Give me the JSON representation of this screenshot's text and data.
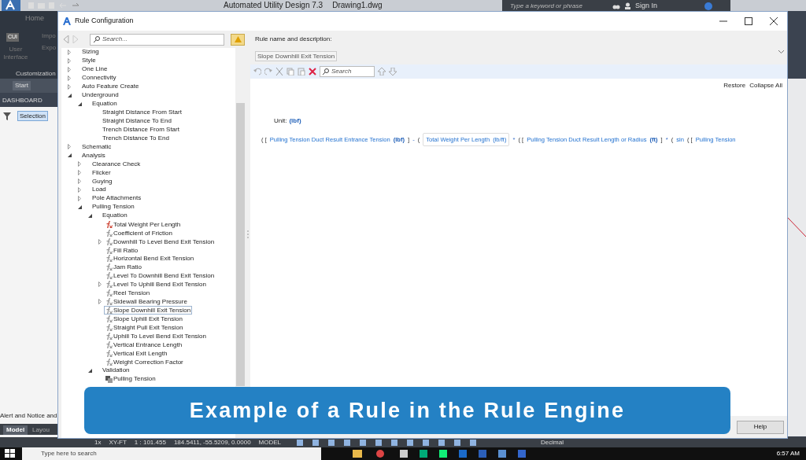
{
  "app": {
    "title": "Automated Utility Design 7.3",
    "document": "Drawing1.dwg",
    "search_placeholder": "Type a keyword or phrase",
    "sign_in": "Sign In",
    "ribbon_tab": "Home",
    "ribbon_items": [
      "Impo",
      "Expo"
    ],
    "cui_label": "CUI",
    "cui_caption": "User Interface",
    "panel_title": "Customization",
    "start_tab": "Start",
    "dashboard": "DASHBOARD",
    "selection": "Selection",
    "alert": "Alert and Notice and",
    "layout_tabs": [
      {
        "label": "Model",
        "selected": true
      },
      {
        "label": "Layou",
        "selected": false
      }
    ]
  },
  "dialog": {
    "title": "Rule Configuration",
    "search_placeholder": "Search...",
    "tree": [
      {
        "label": "Sizing",
        "expanded": false
      },
      {
        "label": "Style",
        "expanded": false
      },
      {
        "label": "One Line",
        "expanded": false
      },
      {
        "label": "Connectivity",
        "expanded": false
      },
      {
        "label": "Auto Feature Create",
        "expanded": false
      },
      {
        "label": "Underground",
        "expanded": true,
        "children": [
          {
            "label": "Equation",
            "expanded": true,
            "children": [
              {
                "label": "Straight Distance From Start"
              },
              {
                "label": "Straight Distance To End"
              },
              {
                "label": "Trench Distance From Start"
              },
              {
                "label": "Trench Distance To End"
              }
            ]
          }
        ]
      },
      {
        "label": "Schematic",
        "expanded": false
      },
      {
        "label": "Analysis",
        "expanded": true,
        "children": [
          {
            "label": "Clearance Check",
            "expanded": false
          },
          {
            "label": "Flicker",
            "expanded": false
          },
          {
            "label": "Guying",
            "expanded": false
          },
          {
            "label": "Load",
            "expanded": false
          },
          {
            "label": "Pole Attachments",
            "expanded": false
          },
          {
            "label": "Pulling Tension",
            "expanded": true,
            "children": [
              {
                "label": "Equation",
                "expanded": true,
                "children": [
                  {
                    "label": "Total Weight Per Length",
                    "kind": "rule",
                    "color": "#d04a3a",
                    "selected": false
                  },
                  {
                    "label": "Coefficient of Friction",
                    "kind": "rule",
                    "color": "#9a9a9a",
                    "selected": false
                  },
                  {
                    "label": "Downhill To Level Bend Exit Tension",
                    "kind": "rule",
                    "color": "#9a9a9a",
                    "selected": false,
                    "expanded": false
                  },
                  {
                    "label": "Fill Ratio",
                    "kind": "rule",
                    "color": "#9a9a9a",
                    "selected": false
                  },
                  {
                    "label": "Horizontal Bend Exit Tension",
                    "kind": "rule",
                    "color": "#9a9a9a",
                    "selected": false
                  },
                  {
                    "label": "Jam Ratio",
                    "kind": "rule",
                    "color": "#9a9a9a",
                    "selected": false
                  },
                  {
                    "label": "Level To Downhill Bend Exit Tension",
                    "kind": "rule",
                    "color": "#9a9a9a",
                    "selected": false
                  },
                  {
                    "label": "Level To Uphill Bend Exit Tension",
                    "kind": "rule",
                    "color": "#9a9a9a",
                    "selected": false,
                    "expanded": false
                  },
                  {
                    "label": "Reel Tension",
                    "kind": "rule",
                    "color": "#9a9a9a",
                    "selected": false
                  },
                  {
                    "label": "Sidewall Bearing Pressure",
                    "kind": "rule",
                    "color": "#9a9a9a",
                    "selected": false,
                    "expanded": false
                  },
                  {
                    "label": "Slope Downhill Exit Tension",
                    "kind": "rule",
                    "color": "#9a9a9a",
                    "selected": true
                  },
                  {
                    "label": "Slope Uphill Exit Tension",
                    "kind": "rule",
                    "color": "#9a9a9a",
                    "selected": false
                  },
                  {
                    "label": "Straight Pull Exit Tension",
                    "kind": "rule",
                    "color": "#9a9a9a",
                    "selected": false
                  },
                  {
                    "label": "Uphill To Level Bend Exit Tension",
                    "kind": "rule",
                    "color": "#9a9a9a",
                    "selected": false
                  },
                  {
                    "label": "Vertical Entrance Length",
                    "kind": "rule",
                    "color": "#9a9a9a",
                    "selected": false
                  },
                  {
                    "label": "Vertical Exit Length",
                    "kind": "rule",
                    "color": "#9a9a9a",
                    "selected": false
                  },
                  {
                    "label": "Weight Correction Factor",
                    "kind": "rule",
                    "color": "#9a9a9a",
                    "selected": false
                  }
                ]
              },
              {
                "label": "Validation",
                "expanded": true,
                "children": [
                  {
                    "label": "Pulling Tension",
                    "kind": "validation"
                  }
                ]
              }
            ]
          }
        ]
      }
    ],
    "rule_label": "Rule name and description:",
    "rule_name": "Slope Downhill Exit Tension",
    "editor_search_placeholder": "Search",
    "links": [
      "Restore",
      "Collapse All"
    ],
    "unit_label": "Unit:",
    "unit": "(lbf)",
    "formula": [
      {
        "kind": "symbol",
        "text": "( ["
      },
      {
        "kind": "name",
        "text": "Pulling Tension Duct Result Entrance Tension"
      },
      {
        "kind": "unit",
        "text": "(lbf)"
      },
      {
        "kind": "symbol",
        "text": "]"
      },
      {
        "kind": "operator",
        "text": "-"
      },
      {
        "kind": "symbol",
        "text": "("
      },
      {
        "kind": "box",
        "text": "Total Weight Per Length",
        "unit": "(lb/ft)"
      },
      {
        "kind": "operator",
        "text": "*"
      },
      {
        "kind": "symbol",
        "text": "( ["
      },
      {
        "kind": "name",
        "text": "Pulling Tension Duct Result Length or Radius"
      },
      {
        "kind": "unit",
        "text": "(ft)"
      },
      {
        "kind": "symbol",
        "text": "]"
      },
      {
        "kind": "operator",
        "text": "*"
      },
      {
        "kind": "symbol",
        "text": "("
      },
      {
        "kind": "name",
        "text": "sin"
      },
      {
        "kind": "symbol",
        "text": "( ["
      },
      {
        "kind": "name",
        "text": "Pulling Tension"
      }
    ],
    "help_button": "Help"
  },
  "status_bar": {
    "scale_factor": "1x",
    "coords_system": "XY-FT",
    "scale": "1 : 101.455",
    "coordinates": "184.5411, -55.5209, 0.0000",
    "space": "MODEL",
    "units": "Decimal"
  },
  "taskbar": {
    "search_placeholder": "Type here to search",
    "time": "6:57 AM"
  },
  "caption": "Example of a Rule in the Rule Engine"
}
